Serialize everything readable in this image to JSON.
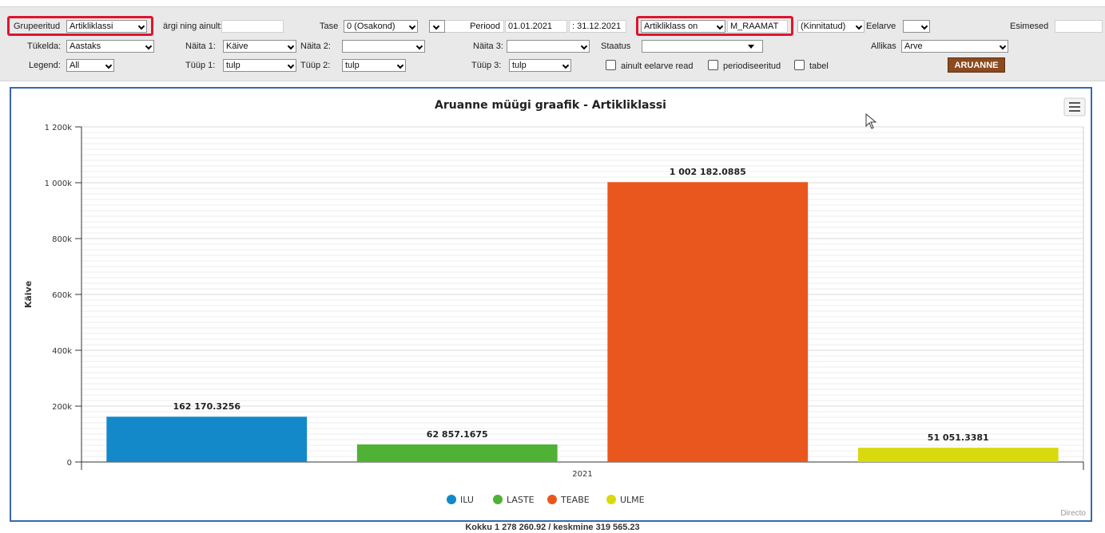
{
  "filters": {
    "grupeeritud": {
      "label": "Grupeeritud",
      "value": "Artikliklassi"
    },
    "margi_ainult": {
      "label": "ärgi ning ainult:",
      "value": ""
    },
    "tase": {
      "label": "Tase",
      "value": "0 (Osakond)"
    },
    "unnamed_select": {
      "value": ""
    },
    "periood": {
      "label": "Periood",
      "from": "01.01.2021",
      "to": ": 31.12.2021"
    },
    "artikliklass_on": {
      "value": "Artikliklass on"
    },
    "m_raamat": {
      "value": "M_RAAMAT"
    },
    "kinnitatud": {
      "value": "(Kinnitatud)"
    },
    "eelarve": {
      "label": "Eelarve",
      "value": ""
    },
    "esimesed": {
      "label": "Esimesed",
      "value": ""
    },
    "tukelda": {
      "label": "Tükelda:",
      "value": "Aastaks"
    },
    "naita1": {
      "label": "Näita 1:",
      "value": "Käive"
    },
    "naita2": {
      "label": "Näita 2:",
      "value": ""
    },
    "naita3": {
      "label": "Näita 3:",
      "value": ""
    },
    "staatus": {
      "label": "Staatus",
      "value": ""
    },
    "allikas": {
      "label": "Allikas",
      "value": "Arve"
    },
    "legend": {
      "label": "Legend:",
      "value": "All"
    },
    "tuup1": {
      "label": "Tüüp 1:",
      "value": "tulp"
    },
    "tuup2": {
      "label": "Tüüp 2:",
      "value": "tulp"
    },
    "tuup3": {
      "label": "Tüüp 3:",
      "value": "tulp"
    },
    "checkbox_eelarve": {
      "label": "ainult eelarve read",
      "checked": false
    },
    "checkbox_periodiseeritud": {
      "label": "periodiseeritud",
      "checked": false
    },
    "checkbox_tabel": {
      "label": "tabel",
      "checked": false
    },
    "run_button": "ARUANNE"
  },
  "highlight_color": "#e0142d",
  "chart_data": {
    "type": "bar",
    "title": "Aruanne müügi graafik - Artikliklassi",
    "xlabel": "",
    "ylabel": "Käive",
    "categories": [
      "2021"
    ],
    "ylim": [
      0,
      1200000
    ],
    "yticks": [
      0,
      200000,
      400000,
      600000,
      800000,
      1000000,
      1200000
    ],
    "ytick_labels": [
      "0",
      "200k",
      "400k",
      "600k",
      "800k",
      "1 000k",
      "1 200k"
    ],
    "grid": true,
    "legend_position": "bottom",
    "series": [
      {
        "name": "ILU",
        "values": [
          162170.3256
        ],
        "label": "162 170.3256",
        "color": "#1389c9"
      },
      {
        "name": "LASTE",
        "values": [
          62857.1675
        ],
        "label": "62 857.1675",
        "color": "#4fb234"
      },
      {
        "name": "TEABE",
        "values": [
          1002182.0885
        ],
        "label": "1 002 182.0885",
        "color": "#ea571e"
      },
      {
        "name": "ULME",
        "values": [
          51051.3381
        ],
        "label": "51 051.3381",
        "color": "#d9d90f"
      }
    ]
  },
  "chart_menu_icon": "hamburger-menu-icon",
  "credit": "Directo",
  "footer_total": "Kokku 1 278 260.92 / keskmine 319 565.23"
}
